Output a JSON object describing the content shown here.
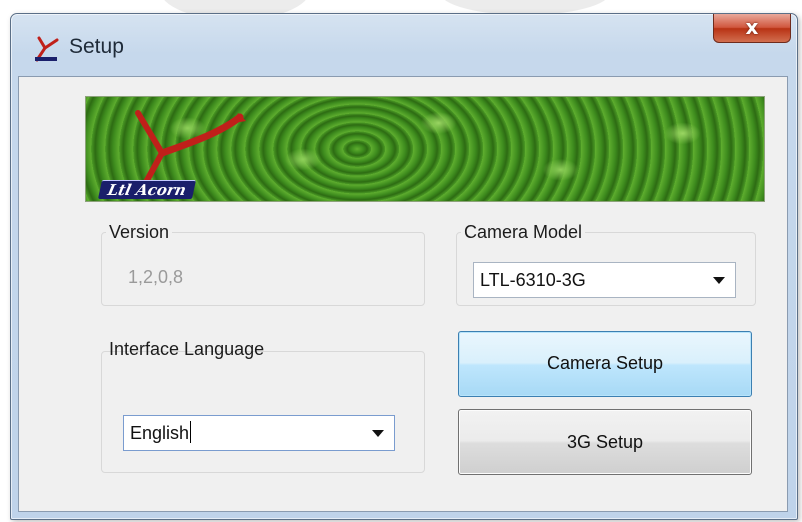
{
  "window": {
    "title": "Setup",
    "close_label": "x"
  },
  "banner": {
    "brand_text": "Ltl Acorn"
  },
  "version_group": {
    "legend": "Version",
    "value": "1,2,0,8"
  },
  "camera_model_group": {
    "legend": "Camera Model",
    "selected": "LTL-6310-3G"
  },
  "language_group": {
    "legend": "Interface Language",
    "selected": "English"
  },
  "buttons": {
    "camera_setup": "Camera Setup",
    "g3_setup": "3G Setup"
  },
  "colors": {
    "accent_button_border": "#3c7fb1",
    "close_button": "#c74a2e",
    "banner_green": "#3f8e22",
    "brand_badge": "#1a1f6b",
    "logo_red": "#c0201a"
  },
  "icons": {
    "app": "ltl-acorn-y-logo-icon",
    "close": "close-icon",
    "dropdown": "chevron-down-icon"
  }
}
